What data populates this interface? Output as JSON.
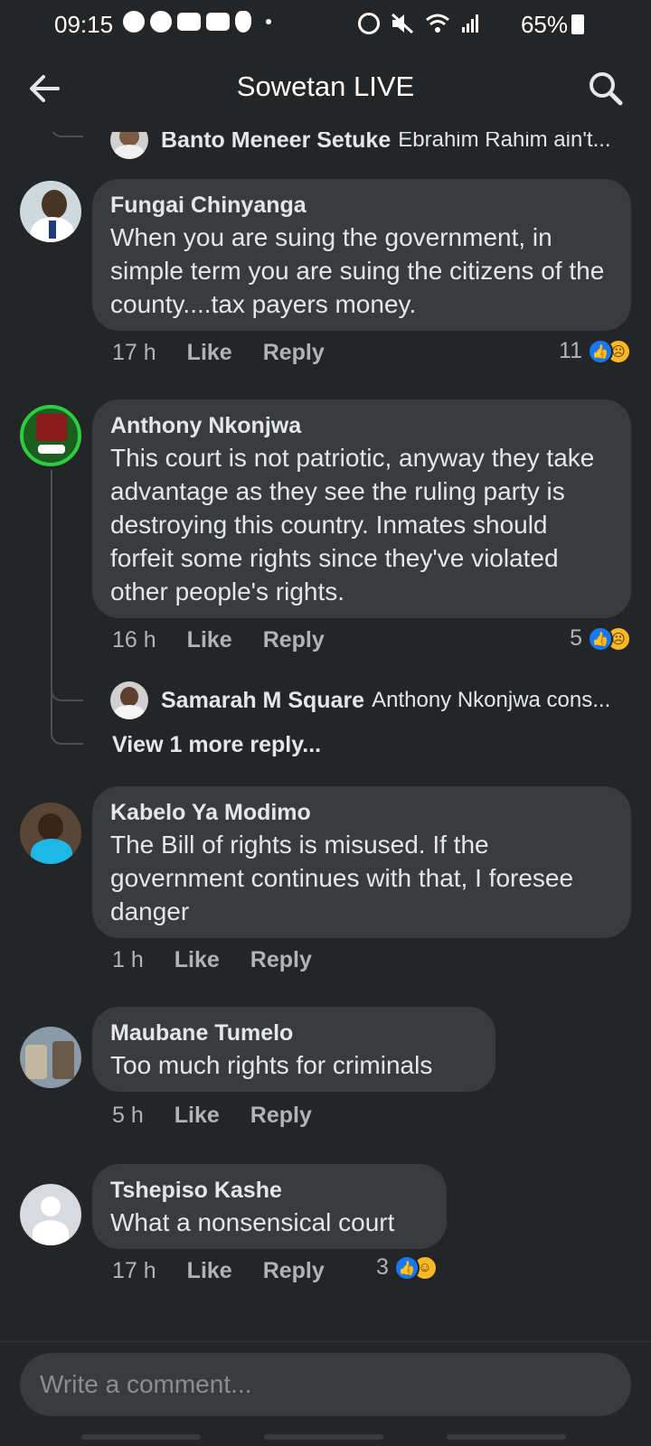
{
  "status_bar": {
    "time": "09:15",
    "battery": "65%",
    "left_icons": [
      "facebook-icon",
      "facebook-icon",
      "youtube-icon",
      "youtube-icon",
      "accessibility-icon"
    ],
    "right_icons": [
      "alarm-icon",
      "mute-icon",
      "wifi-icon",
      "signal-icon"
    ]
  },
  "header": {
    "title": "Sowetan LIVE",
    "back_icon": "arrow-left-icon",
    "search_icon": "search-icon"
  },
  "top_reply_preview": {
    "name": "Banto Meneer Setuke",
    "snippet": "Ebrahim Rahim ain't..."
  },
  "comments": [
    {
      "author": "Fungai Chinyanga",
      "text": "When you are suing the government, in simple term you are suing the citizens of the county....tax payers money.",
      "time": "17 h",
      "like": "Like",
      "reply": "Reply",
      "reaction_count": "11"
    },
    {
      "author": "Anthony Nkonjwa",
      "text": "This court is not patriotic, anyway they take advantage as they see the ruling party is destroying this country. Inmates should forfeit some rights since they've violated other people's rights.",
      "time": "16 h",
      "like": "Like",
      "reply": "Reply",
      "reaction_count": "5",
      "reply_preview": {
        "name": "Samarah M Square",
        "snippet": "Anthony Nkonjwa cons..."
      },
      "view_more": "View 1 more reply..."
    },
    {
      "author": "Kabelo Ya Modimo",
      "text": "The Bill of rights is misused. If the government continues with that, I foresee danger",
      "time": "1 h",
      "like": "Like",
      "reply": "Reply"
    },
    {
      "author": "Maubane Tumelo",
      "text": "Too much rights for criminals",
      "time": "5 h",
      "like": "Like",
      "reply": "Reply"
    },
    {
      "author": "Tshepiso Kashe",
      "text": "What a nonsensical court",
      "time": "17 h",
      "like": "Like",
      "reply": "Reply",
      "reaction_count": "3"
    }
  ],
  "composer": {
    "placeholder": "Write a comment..."
  },
  "colors": {
    "background": "#242526",
    "bubble": "#3a3b3c",
    "like_blue": "#1877f2",
    "sad_yellow": "#f7b928"
  }
}
